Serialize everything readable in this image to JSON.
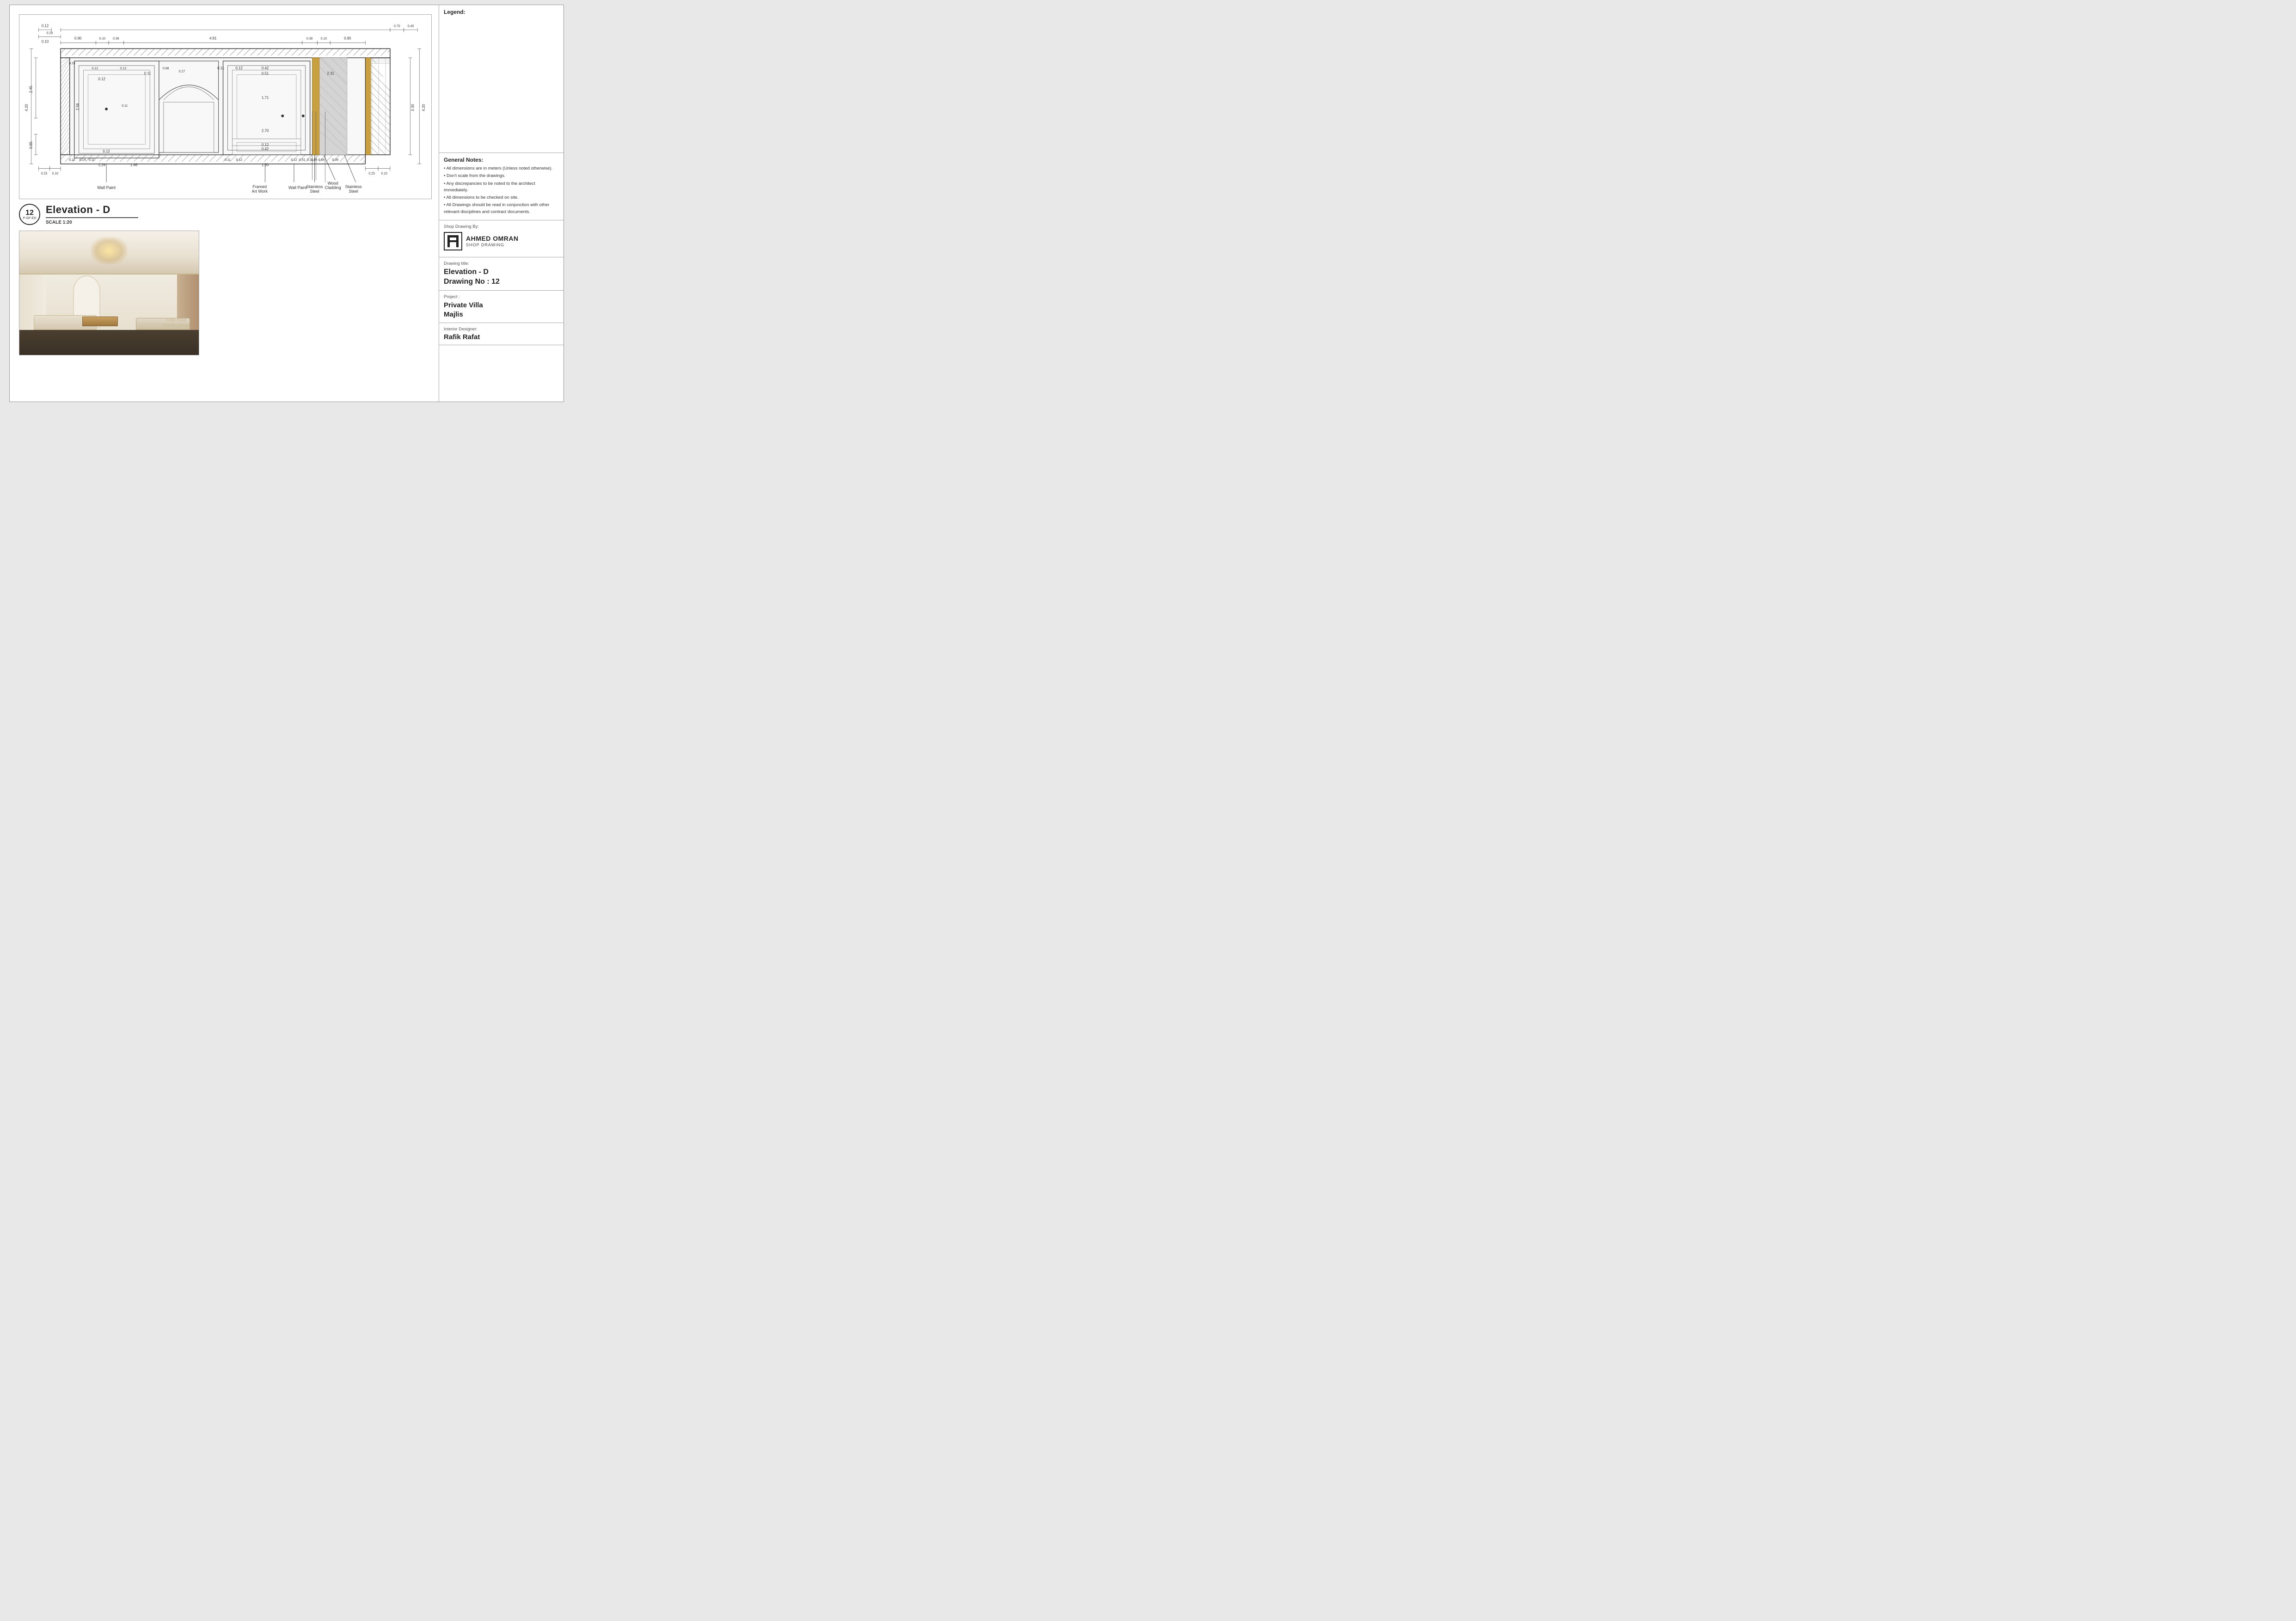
{
  "page": {
    "title": "Elevation D - Shop Drawing"
  },
  "legend": {
    "title": "Legend:"
  },
  "general_notes": {
    "title": "General Notes:",
    "items": [
      "All dimensions are in meters (Unless noted otherwise).",
      "Don't scale from the drawings.",
      "Any discrepancies to be noted to the architect immediately.",
      "All dimensions to be checked on site.",
      "All Drawings should be read in conjunction with other relevant disciplines and contract documents."
    ]
  },
  "shop_drawing": {
    "label": "Shop Drawing By:",
    "company_name": "AHMED OMRAN",
    "company_subtitle": "SHOP DRAWING"
  },
  "drawing_info": {
    "title_label": "Drawing title:",
    "title_value": "Elevation - D",
    "drawing_no_label": "Drawing No : 12",
    "project_label": "Project :",
    "project_value": "Private Villa\nMajlis",
    "designer_label": "Interior Designer:",
    "designer_value": "Rafik Rafat"
  },
  "elevation": {
    "title": "Elevation - D",
    "scale": "SCALE 1:20",
    "drawing_number": "12",
    "drawing_code": "P-GF-ED"
  },
  "labels": {
    "wall_paint_left": "Wall Paint",
    "framed_art_work": "Framed\nArt Work",
    "wall_paint_right": "Wall Paint",
    "stainless_steel_1": "Stainless\nSteel",
    "wood_cladding": "Wood\nCladding",
    "stainless_steel_2": "Stainless\nSteel"
  },
  "watermark": {
    "line1": "Rafik Rafat",
    "line2": "Interior Design"
  },
  "dimensions": {
    "overall_width": "4.81",
    "left_margin": "0.12",
    "right_margin": "0.12",
    "height_total": "4.20",
    "dim_090_left": "0.90",
    "dim_010_1": "0.10",
    "dim_038_1": "0.38",
    "dim_090_right": "0.90",
    "dim_010_2": "0.10",
    "dim_070": "0.70",
    "dim_040": "0.40",
    "dim_330": "3.30"
  }
}
